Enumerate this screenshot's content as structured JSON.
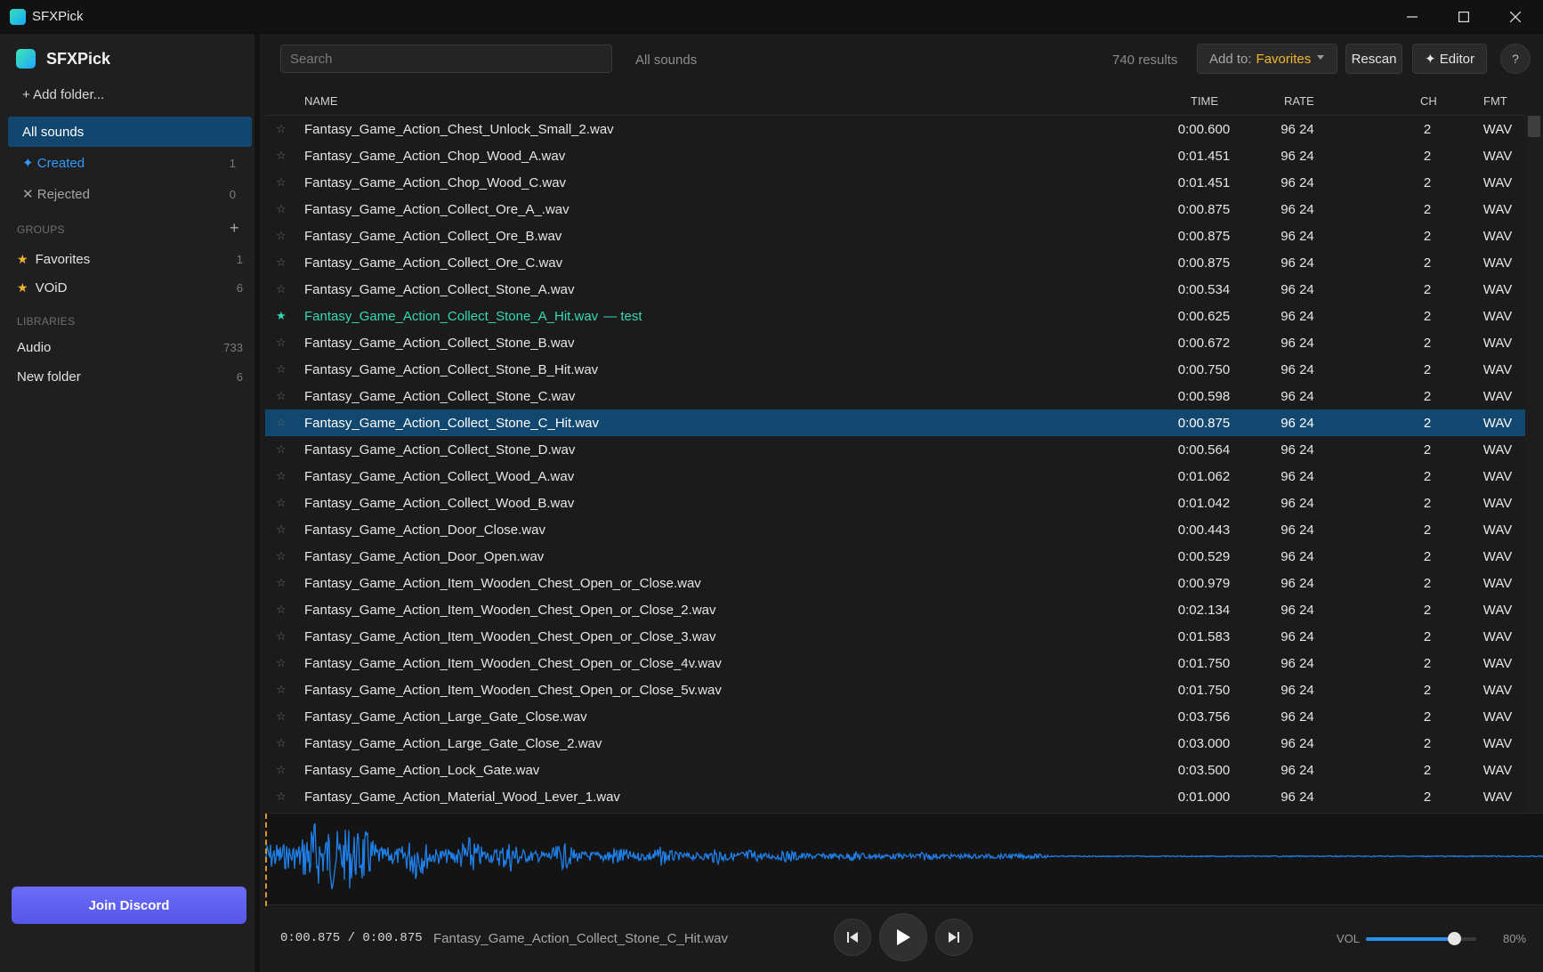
{
  "window": {
    "title": "SFXPick"
  },
  "sidebar": {
    "brand": "SFXPick",
    "add_folder": "+ Add folder...",
    "nav": [
      {
        "label": "All sounds",
        "count": ""
      },
      {
        "label": "✦ Created",
        "count": "1"
      },
      {
        "label": "✕ Rejected",
        "count": "0"
      }
    ],
    "groups_label": "GROUPS",
    "groups_add": "+",
    "groups": [
      {
        "star": "★",
        "label": "Favorites",
        "count": "1"
      },
      {
        "star": "★",
        "label": "VOiD",
        "count": "6"
      }
    ],
    "libraries_label": "LIBRARIES",
    "libraries": [
      {
        "label": "Audio",
        "count": "733"
      },
      {
        "label": "New folder",
        "count": "6"
      }
    ],
    "discord": "Join Discord"
  },
  "toolbar": {
    "search_placeholder": "Search",
    "scope": "All sounds",
    "results": "740 results",
    "add_to_label": "Add to:",
    "add_to_value": "Favorites",
    "rescan": "Rescan",
    "editor": "✦ Editor",
    "help": "?"
  },
  "columns": {
    "name": "NAME",
    "time": "TIME",
    "rate": "RATE",
    "ch": "CH",
    "fmt": "FMT"
  },
  "rows": [
    {
      "name": "Fantasy_Game_Action_Chest_Unlock_Small_2.wav",
      "time": "0:00.600",
      "rate": "96 24",
      "ch": "2",
      "fmt": "WAV",
      "fav": false,
      "note": ""
    },
    {
      "name": "Fantasy_Game_Action_Chop_Wood_A.wav",
      "time": "0:01.451",
      "rate": "96 24",
      "ch": "2",
      "fmt": "WAV",
      "fav": false,
      "note": ""
    },
    {
      "name": "Fantasy_Game_Action_Chop_Wood_C.wav",
      "time": "0:01.451",
      "rate": "96 24",
      "ch": "2",
      "fmt": "WAV",
      "fav": false,
      "note": ""
    },
    {
      "name": "Fantasy_Game_Action_Collect_Ore_A_.wav",
      "time": "0:00.875",
      "rate": "96 24",
      "ch": "2",
      "fmt": "WAV",
      "fav": false,
      "note": ""
    },
    {
      "name": "Fantasy_Game_Action_Collect_Ore_B.wav",
      "time": "0:00.875",
      "rate": "96 24",
      "ch": "2",
      "fmt": "WAV",
      "fav": false,
      "note": ""
    },
    {
      "name": "Fantasy_Game_Action_Collect_Ore_C.wav",
      "time": "0:00.875",
      "rate": "96 24",
      "ch": "2",
      "fmt": "WAV",
      "fav": false,
      "note": ""
    },
    {
      "name": "Fantasy_Game_Action_Collect_Stone_A.wav",
      "time": "0:00.534",
      "rate": "96 24",
      "ch": "2",
      "fmt": "WAV",
      "fav": false,
      "note": ""
    },
    {
      "name": "Fantasy_Game_Action_Collect_Stone_A_Hit.wav",
      "time": "0:00.625",
      "rate": "96 24",
      "ch": "2",
      "fmt": "WAV",
      "fav": true,
      "note": "— test"
    },
    {
      "name": "Fantasy_Game_Action_Collect_Stone_B.wav",
      "time": "0:00.672",
      "rate": "96 24",
      "ch": "2",
      "fmt": "WAV",
      "fav": false,
      "note": ""
    },
    {
      "name": "Fantasy_Game_Action_Collect_Stone_B_Hit.wav",
      "time": "0:00.750",
      "rate": "96 24",
      "ch": "2",
      "fmt": "WAV",
      "fav": false,
      "note": ""
    },
    {
      "name": "Fantasy_Game_Action_Collect_Stone_C.wav",
      "time": "0:00.598",
      "rate": "96 24",
      "ch": "2",
      "fmt": "WAV",
      "fav": false,
      "note": ""
    },
    {
      "name": "Fantasy_Game_Action_Collect_Stone_C_Hit.wav",
      "time": "0:00.875",
      "rate": "96 24",
      "ch": "2",
      "fmt": "WAV",
      "fav": false,
      "note": "",
      "selected": true
    },
    {
      "name": "Fantasy_Game_Action_Collect_Stone_D.wav",
      "time": "0:00.564",
      "rate": "96 24",
      "ch": "2",
      "fmt": "WAV",
      "fav": false,
      "note": ""
    },
    {
      "name": "Fantasy_Game_Action_Collect_Wood_A.wav",
      "time": "0:01.062",
      "rate": "96 24",
      "ch": "2",
      "fmt": "WAV",
      "fav": false,
      "note": ""
    },
    {
      "name": "Fantasy_Game_Action_Collect_Wood_B.wav",
      "time": "0:01.042",
      "rate": "96 24",
      "ch": "2",
      "fmt": "WAV",
      "fav": false,
      "note": ""
    },
    {
      "name": "Fantasy_Game_Action_Door_Close.wav",
      "time": "0:00.443",
      "rate": "96 24",
      "ch": "2",
      "fmt": "WAV",
      "fav": false,
      "note": ""
    },
    {
      "name": "Fantasy_Game_Action_Door_Open.wav",
      "time": "0:00.529",
      "rate": "96 24",
      "ch": "2",
      "fmt": "WAV",
      "fav": false,
      "note": ""
    },
    {
      "name": "Fantasy_Game_Action_Item_Wooden_Chest_Open_or_Close.wav",
      "time": "0:00.979",
      "rate": "96 24",
      "ch": "2",
      "fmt": "WAV",
      "fav": false,
      "note": ""
    },
    {
      "name": "Fantasy_Game_Action_Item_Wooden_Chest_Open_or_Close_2.wav",
      "time": "0:02.134",
      "rate": "96 24",
      "ch": "2",
      "fmt": "WAV",
      "fav": false,
      "note": ""
    },
    {
      "name": "Fantasy_Game_Action_Item_Wooden_Chest_Open_or_Close_3.wav",
      "time": "0:01.583",
      "rate": "96 24",
      "ch": "2",
      "fmt": "WAV",
      "fav": false,
      "note": ""
    },
    {
      "name": "Fantasy_Game_Action_Item_Wooden_Chest_Open_or_Close_4v.wav",
      "time": "0:01.750",
      "rate": "96 24",
      "ch": "2",
      "fmt": "WAV",
      "fav": false,
      "note": ""
    },
    {
      "name": "Fantasy_Game_Action_Item_Wooden_Chest_Open_or_Close_5v.wav",
      "time": "0:01.750",
      "rate": "96 24",
      "ch": "2",
      "fmt": "WAV",
      "fav": false,
      "note": ""
    },
    {
      "name": "Fantasy_Game_Action_Large_Gate_Close.wav",
      "time": "0:03.756",
      "rate": "96 24",
      "ch": "2",
      "fmt": "WAV",
      "fav": false,
      "note": ""
    },
    {
      "name": "Fantasy_Game_Action_Large_Gate_Close_2.wav",
      "time": "0:03.000",
      "rate": "96 24",
      "ch": "2",
      "fmt": "WAV",
      "fav": false,
      "note": ""
    },
    {
      "name": "Fantasy_Game_Action_Lock_Gate.wav",
      "time": "0:03.500",
      "rate": "96 24",
      "ch": "2",
      "fmt": "WAV",
      "fav": false,
      "note": ""
    },
    {
      "name": "Fantasy_Game_Action_Material_Wood_Lever_1.wav",
      "time": "0:01.000",
      "rate": "96 24",
      "ch": "2",
      "fmt": "WAV",
      "fav": false,
      "note": ""
    }
  ],
  "player": {
    "position": "0:00.875 / 0:00.875",
    "file": "Fantasy_Game_Action_Collect_Stone_C_Hit.wav",
    "vol_label": "VOL",
    "volume": 0.8,
    "volume_text": "80%"
  },
  "icons": {
    "star": "star-icon",
    "prev": "skip-previous-icon",
    "play": "play-icon",
    "next": "skip-next-icon",
    "minimize": "minimize-icon",
    "maximize": "maximize-icon",
    "close": "close-icon"
  },
  "colors": {
    "accent": "#2c8ef0",
    "selection": "#12476f",
    "favorite": "#35d9b3",
    "gold": "#f3b62b",
    "discord": "#5d5df0",
    "waveform": "#1f7fe8"
  }
}
